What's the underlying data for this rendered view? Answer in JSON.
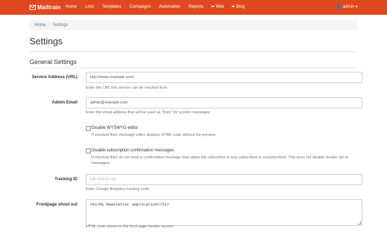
{
  "navbar": {
    "brand": "Mailtrain",
    "brand_icon": "envelope-icon",
    "items": [
      "Home",
      "Lists",
      "Templates",
      "Campaigns",
      "Automation",
      "Reports",
      "Wiki",
      "Blog"
    ],
    "wiki_icon": "external-link-icon",
    "blog_icon": "external-link-icon",
    "user": "admin",
    "user_icon": "user-icon",
    "bg_color": "#e0491f"
  },
  "breadcrumb": {
    "home": "Home",
    "separator": "/",
    "current": "Settings"
  },
  "page": {
    "title": "Settings",
    "section": "General Settings"
  },
  "form": {
    "service_url": {
      "label": "Service Address (URL)",
      "value": "http://news.example.com/",
      "help": "Enter the URL this service can be reached from"
    },
    "admin_email": {
      "label": "Admin Email",
      "value": "admin@example.com",
      "help": "Enter the email address that will be used as \"from\" for system messages"
    },
    "wysiwyg": {
      "label": "Disable WYSWYG editor",
      "help": "If checked then message editor displays HTML code without the preview",
      "checked": false
    },
    "disable_confirmations": {
      "label": "Disable subscription confirmation messages",
      "help": "If checked then do not send a confirmation message that states the subscriber is now subscribed or unsubscribed. This does not disable double opt-in messages.",
      "checked": false
    },
    "tracking_id": {
      "label": "Tracking ID",
      "placeholder": "UA-XXXXX-XX",
      "help": "Enter Google Analytics tracking code"
    },
    "shoutout": {
      "label": "Frontpage shout out",
      "value": "<h1>My Newsletter application</h1>",
      "help": "HTML code shown in the front page header section"
    }
  }
}
